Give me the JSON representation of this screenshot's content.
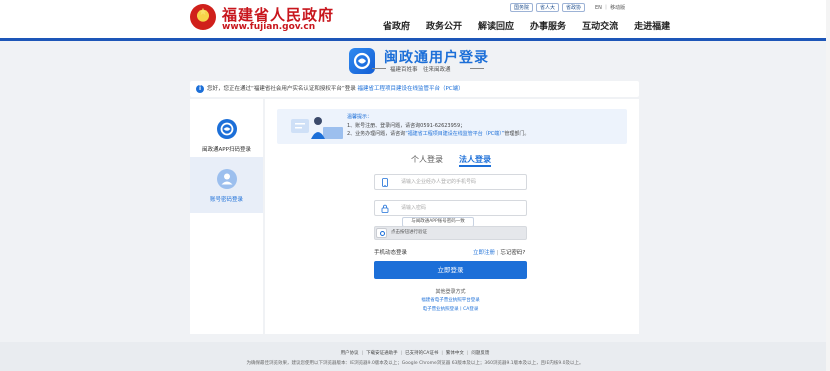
{
  "header": {
    "site_name": "福建省人民政府",
    "site_url": "www.fujian.gov.cn",
    "top_links": [
      "国务院",
      "省人大",
      "省政协"
    ],
    "lang": "EN ｜ 移动版",
    "nav": [
      "省政府",
      "政务公开",
      "解读回应",
      "办事服务",
      "互动交流",
      "走进福建"
    ]
  },
  "login": {
    "title": "闽政通用户登录",
    "subtitle": "福建百姓事　往来闽政通"
  },
  "notice": {
    "prefix": "您好，您正在通过“福建省社会用户实名认证和授权平台”登录",
    "link": "福建省工程项目建设在线监管平台（PC端）"
  },
  "left_panel": {
    "items": [
      {
        "label": "闽政通APP扫码登录"
      },
      {
        "label": "账号密码登录"
      }
    ]
  },
  "warm_tips": {
    "title": "温馨提示：",
    "line1": "1、账号注册、登录问题，请咨询0591-62623959；",
    "line2_prefix": "2、业务办理问题，请咨询",
    "line2_link": "“福建省工程项目建设在线监管平台（PC端）”",
    "line2_suffix": "管理部门。"
  },
  "tabs": [
    {
      "label": "个人登录",
      "active": false
    },
    {
      "label": "法人登录",
      "active": true
    }
  ],
  "form": {
    "phone_placeholder": "请输入企业经办人登记的手机号码",
    "password_placeholder": "请输入密码",
    "tooltip": "与闽政通APP账号密码一致",
    "slider_text": "点击按钮进行验证",
    "phone_login": "手机动态登录",
    "register": "立即注册",
    "forgot": "忘记密码?",
    "submit": "立即登录",
    "other_title": "其他登录方式",
    "other_links": [
      "福建省电子营业执照平台登录",
      "电子营业执照登录丨CA登录"
    ]
  },
  "footer": {
    "links": [
      "用户协议",
      "下载安证通助手",
      "已支持的CA证书",
      "繁体中文",
      "问题反馈"
    ],
    "note": "为确保最佳浏览效果，建议您使用以下浏览器版本：IE浏览器9.0版本及以上；Google Chrome浏览器 63版本及以上；360浏览器9.1版本及以上，且IE内核9.0及以上。"
  },
  "colors": {
    "brand_red": "#c8161d",
    "accent_blue": "#1c6fd8"
  }
}
